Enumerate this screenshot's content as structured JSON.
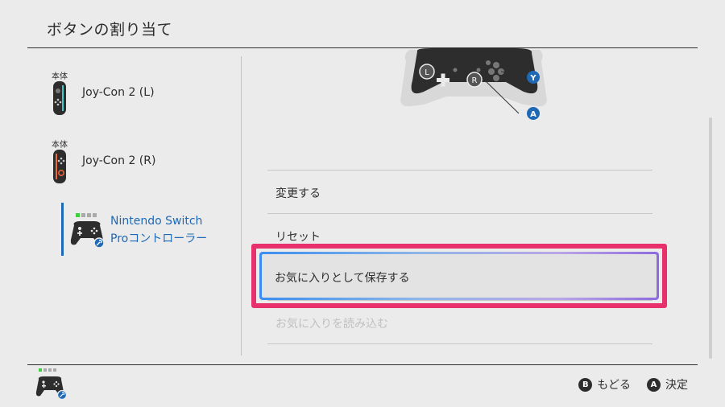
{
  "header": {
    "title": "ボタンの割り当て"
  },
  "sidebar": {
    "items": [
      {
        "badge": "本体",
        "name": "Joy-Con 2 (L)"
      },
      {
        "badge": "本体",
        "name": "Joy-Con 2 (R)"
      },
      {
        "name_line1": "Nintendo Switch",
        "name_line2": "Proコントローラー",
        "selected": true
      }
    ]
  },
  "illustration": {
    "letters": {
      "L": "L",
      "R": "R",
      "Y": "Y",
      "A": "A"
    }
  },
  "menu": {
    "items": [
      {
        "label": "変更する",
        "enabled": true
      },
      {
        "label": "リセット",
        "enabled": true
      },
      {
        "label": "お気に入りとして保存する",
        "enabled": true,
        "focused": true
      },
      {
        "label": "お気に入りを読み込む",
        "enabled": false
      }
    ]
  },
  "footer": {
    "back": {
      "button": "B",
      "label": "もどる"
    },
    "confirm": {
      "button": "A",
      "label": "決定"
    }
  },
  "colors": {
    "accent": "#1f68b5",
    "highlight": "#e8306c"
  }
}
